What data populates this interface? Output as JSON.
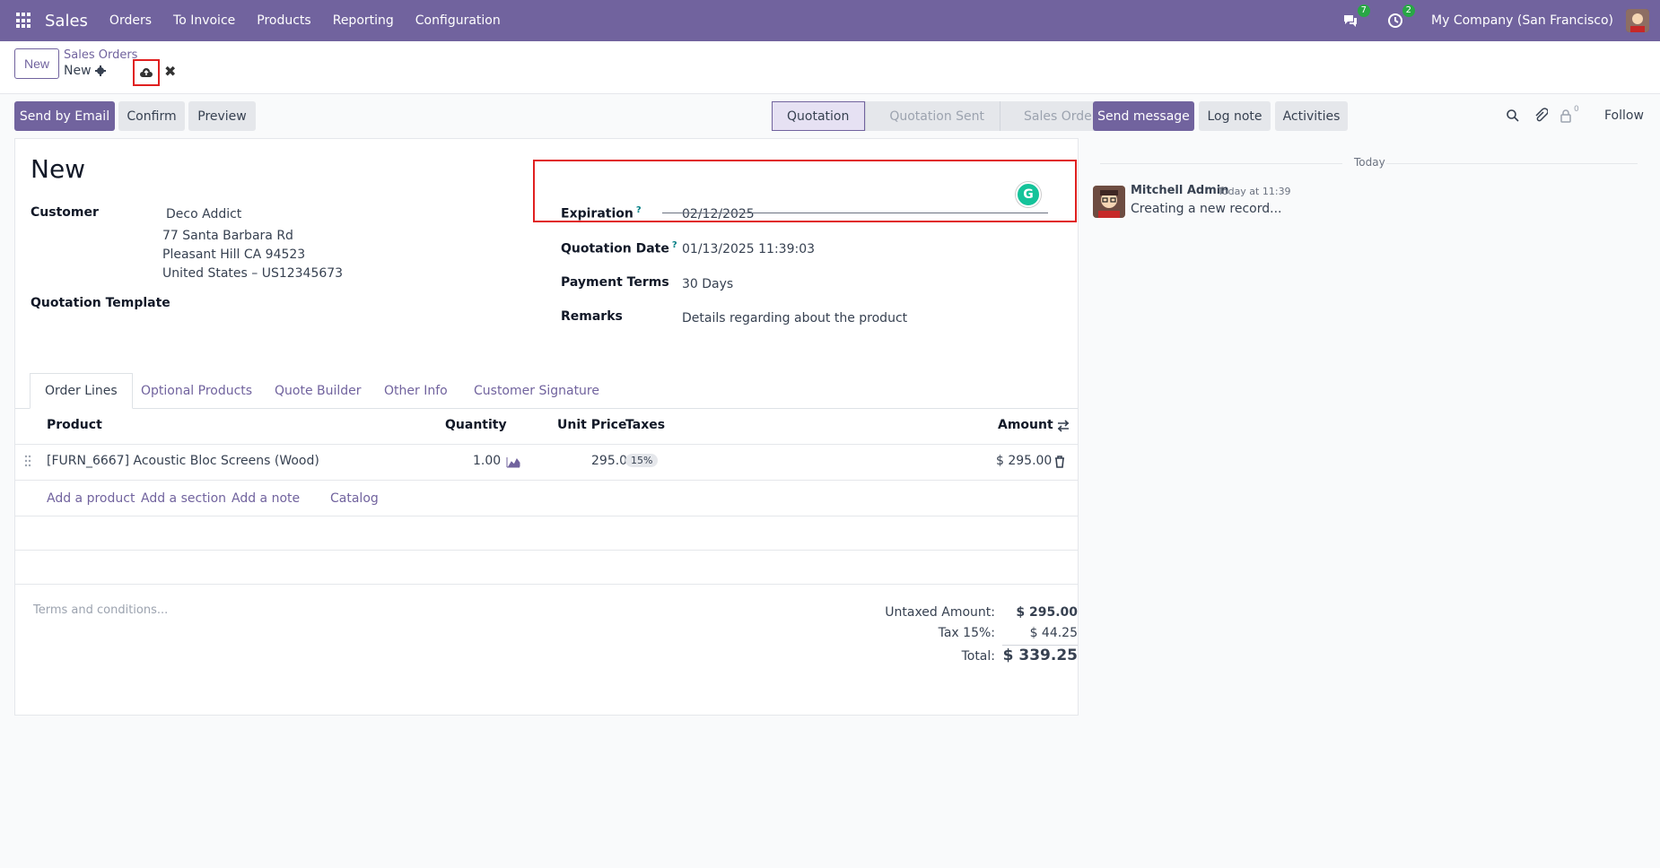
{
  "navbar": {
    "app_name": "Sales",
    "menu": [
      "Orders",
      "To Invoice",
      "Products",
      "Reporting",
      "Configuration"
    ],
    "messages_badge": "7",
    "activities_badge": "2",
    "company": "My Company (San Francisco)"
  },
  "control": {
    "new_label": "New",
    "breadcrumb_parent": "Sales Orders",
    "breadcrumb_current": "New"
  },
  "actions": {
    "send_email": "Send by Email",
    "confirm": "Confirm",
    "preview": "Preview"
  },
  "status": {
    "stages": [
      "Quotation",
      "Quotation Sent",
      "Sales Order"
    ],
    "active": "Quotation"
  },
  "form": {
    "title": "New",
    "customer_label": "Customer",
    "customer_name": "Deco Addict",
    "address_line1": "77 Santa Barbara Rd",
    "address_line2": "Pleasant Hill CA 94523",
    "address_line3": "United States – US12345673",
    "template_label": "Quotation Template",
    "expiration_label": "Expiration",
    "expiration_value": "02/12/2025",
    "quotation_date_label": "Quotation Date",
    "quotation_date_value": "01/13/2025 11:39:03",
    "payment_terms_label": "Payment Terms",
    "payment_terms_value": "30 Days",
    "remarks_label": "Remarks",
    "remarks_value": "Details regarding about the product",
    "help_mark": "?"
  },
  "tabs": [
    "Order Lines",
    "Optional Products",
    "Quote Builder",
    "Other Info",
    "Customer Signature"
  ],
  "table": {
    "headers": {
      "product": "Product",
      "quantity": "Quantity",
      "unit_price": "Unit Price",
      "taxes": "Taxes",
      "amount": "Amount"
    },
    "rows": [
      {
        "product": "[FURN_6667] Acoustic Bloc Screens (Wood)",
        "quantity": "1.00",
        "unit_price": "295.00",
        "tax": "15%",
        "amount": "$ 295.00"
      }
    ],
    "add_links": [
      "Add a product",
      "Add a section",
      "Add a note",
      "Catalog"
    ]
  },
  "terms_placeholder": "Terms and conditions...",
  "totals": {
    "untaxed_label": "Untaxed Amount:",
    "untaxed_value": "$ 295.00",
    "tax_label": "Tax 15%:",
    "tax_value": "$ 44.25",
    "total_label": "Total:",
    "total_value": "$ 339.25"
  },
  "chatter": {
    "send_message": "Send message",
    "log_note": "Log note",
    "activities": "Activities",
    "followers_count": "0",
    "follow": "Follow",
    "today_label": "Today",
    "author": "Mitchell Admin",
    "time": "Today at 11:39",
    "body": "Creating a new record..."
  },
  "colors": {
    "brand": "#71639e",
    "highlight": "#e02020"
  }
}
